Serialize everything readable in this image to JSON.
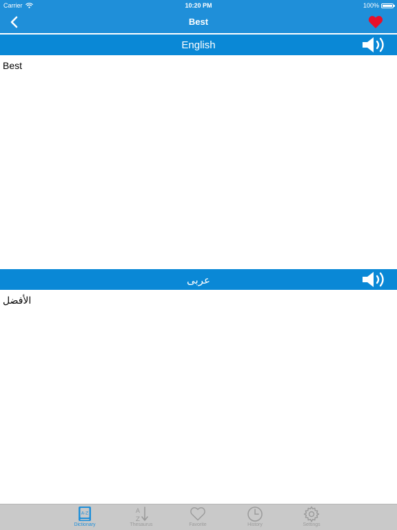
{
  "status_bar": {
    "carrier": "Carrier",
    "time": "10:20 PM",
    "battery": "100%",
    "battery_level": 1.0
  },
  "nav": {
    "back_icon": "chevron-left-icon",
    "title": "Best",
    "favorite_icon": "heart-icon"
  },
  "source": {
    "language": "English",
    "text": "Best",
    "speaker_icon": "speaker-icon"
  },
  "target": {
    "language": "عربى",
    "text": "الأفضل",
    "speaker_icon": "speaker-icon"
  },
  "tabs": [
    {
      "label": "Dictionary",
      "icon": "dictionary-icon",
      "active": true
    },
    {
      "label": "Thesaurus",
      "icon": "thesaurus-icon",
      "active": false
    },
    {
      "label": "Favorite",
      "icon": "heart-icon",
      "active": false
    },
    {
      "label": "History",
      "icon": "clock-icon",
      "active": false
    },
    {
      "label": "Settings",
      "icon": "gear-icon",
      "active": false
    }
  ],
  "colors": {
    "nav_blue": "#1f8fd9",
    "section_blue": "#0a88d6",
    "heart_red": "#e8102a",
    "tab_active": "#1f8fd9",
    "tab_inactive": "#9a9a9a",
    "tabbar_bg": "#c9c9c9"
  }
}
